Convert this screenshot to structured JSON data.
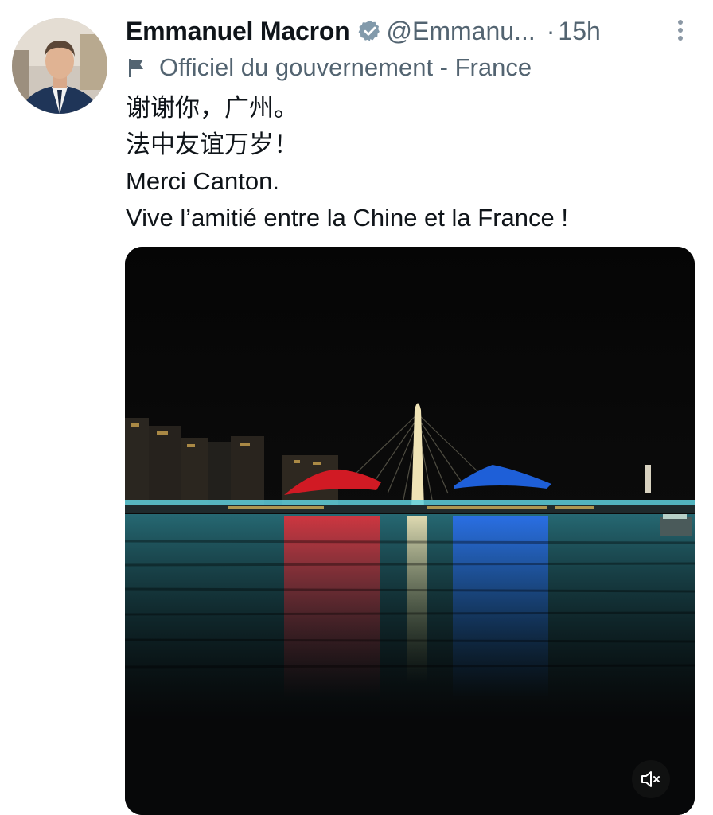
{
  "tweet": {
    "author": {
      "display_name": "Emmanuel Macron",
      "handle": "@Emmanu...",
      "verified_icon": "verified-badge-icon",
      "avatar_alt": "avatar"
    },
    "time_separator": "·",
    "timestamp": "15h",
    "more_icon": "more-vertical-icon",
    "affiliation": {
      "icon": "flag-icon",
      "label": "Officiel du gouvernement - France"
    },
    "text_lines": [
      "谢谢你，广州。",
      "法中友谊万岁！",
      "Merci Canton.",
      "Vive l’amitié entre la Chine et la France !"
    ],
    "media": {
      "type": "video",
      "mute_icon": "volume-muted-icon"
    }
  },
  "colors": {
    "text_primary": "#0f1419",
    "text_secondary": "#536471",
    "verified": "#829aab",
    "media_red": "#d11a24",
    "media_blue": "#1e5fd8"
  }
}
